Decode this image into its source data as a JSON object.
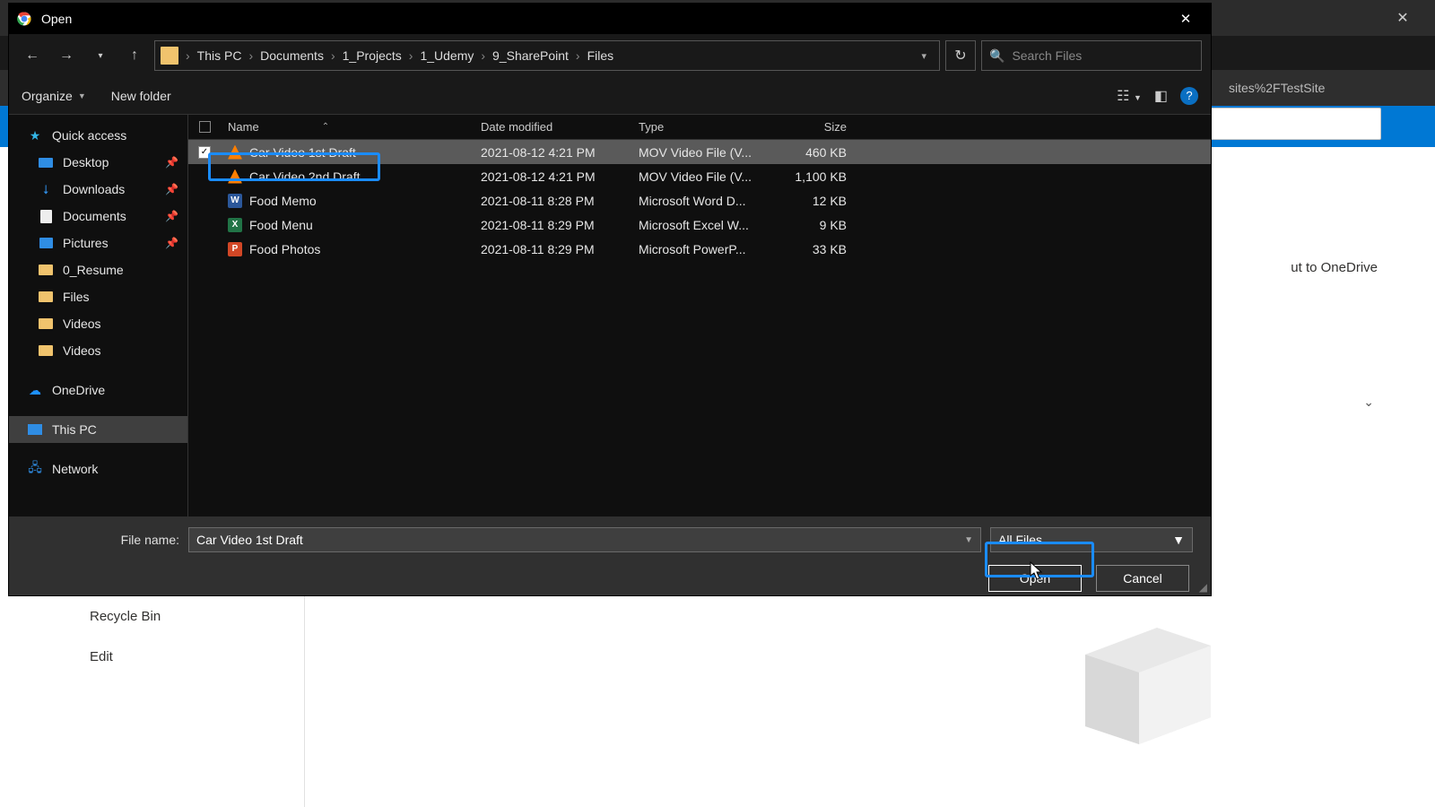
{
  "dialog": {
    "title": "Open",
    "breadcrumbs": [
      "This PC",
      "Documents",
      "1_Projects",
      "1_Udemy",
      "9_SharePoint",
      "Files"
    ],
    "search_placeholder": "Search Files",
    "toolbar": {
      "organize": "Organize",
      "new_folder": "New folder"
    },
    "columns": {
      "name": "Name",
      "date": "Date modified",
      "type": "Type",
      "size": "Size"
    },
    "files": [
      {
        "name": "Car Video 1st Draft",
        "date": "2021-08-12 4:21 PM",
        "type": "MOV Video File (V...",
        "size": "460 KB",
        "icon": "vlc",
        "selected": true,
        "checked": true
      },
      {
        "name": "Car Video 2nd Draft",
        "date": "2021-08-12 4:21 PM",
        "type": "MOV Video File (V...",
        "size": "1,100 KB",
        "icon": "vlc",
        "selected": false,
        "checked": false
      },
      {
        "name": "Food Memo",
        "date": "2021-08-11 8:28 PM",
        "type": "Microsoft Word D...",
        "size": "12 KB",
        "icon": "word",
        "selected": false,
        "checked": false
      },
      {
        "name": "Food Menu",
        "date": "2021-08-11 8:29 PM",
        "type": "Microsoft Excel W...",
        "size": "9 KB",
        "icon": "excel",
        "selected": false,
        "checked": false
      },
      {
        "name": "Food Photos",
        "date": "2021-08-11 8:29 PM",
        "type": "Microsoft PowerP...",
        "size": "33 KB",
        "icon": "ppt",
        "selected": false,
        "checked": false
      }
    ],
    "sidebar": {
      "quick_access": "Quick access",
      "items_pinned": [
        {
          "label": "Desktop",
          "icon": "desktop"
        },
        {
          "label": "Downloads",
          "icon": "down"
        },
        {
          "label": "Documents",
          "icon": "doc"
        },
        {
          "label": "Pictures",
          "icon": "pic"
        }
      ],
      "items_folders": [
        {
          "label": "0_Resume"
        },
        {
          "label": "Files"
        },
        {
          "label": "Videos"
        },
        {
          "label": "Videos"
        }
      ],
      "onedrive": "OneDrive",
      "this_pc": "This PC",
      "network": "Network"
    },
    "filename_label": "File name:",
    "filename_value": "Car Video 1st Draft",
    "filter_value": "All Files",
    "open_button": "Open",
    "cancel_button": "Cancel"
  },
  "background": {
    "url_fragment": "sites%2FTestSite",
    "right_text": "ut to OneDrive",
    "side_items": [
      "Recycle Bin",
      "Edit"
    ]
  }
}
